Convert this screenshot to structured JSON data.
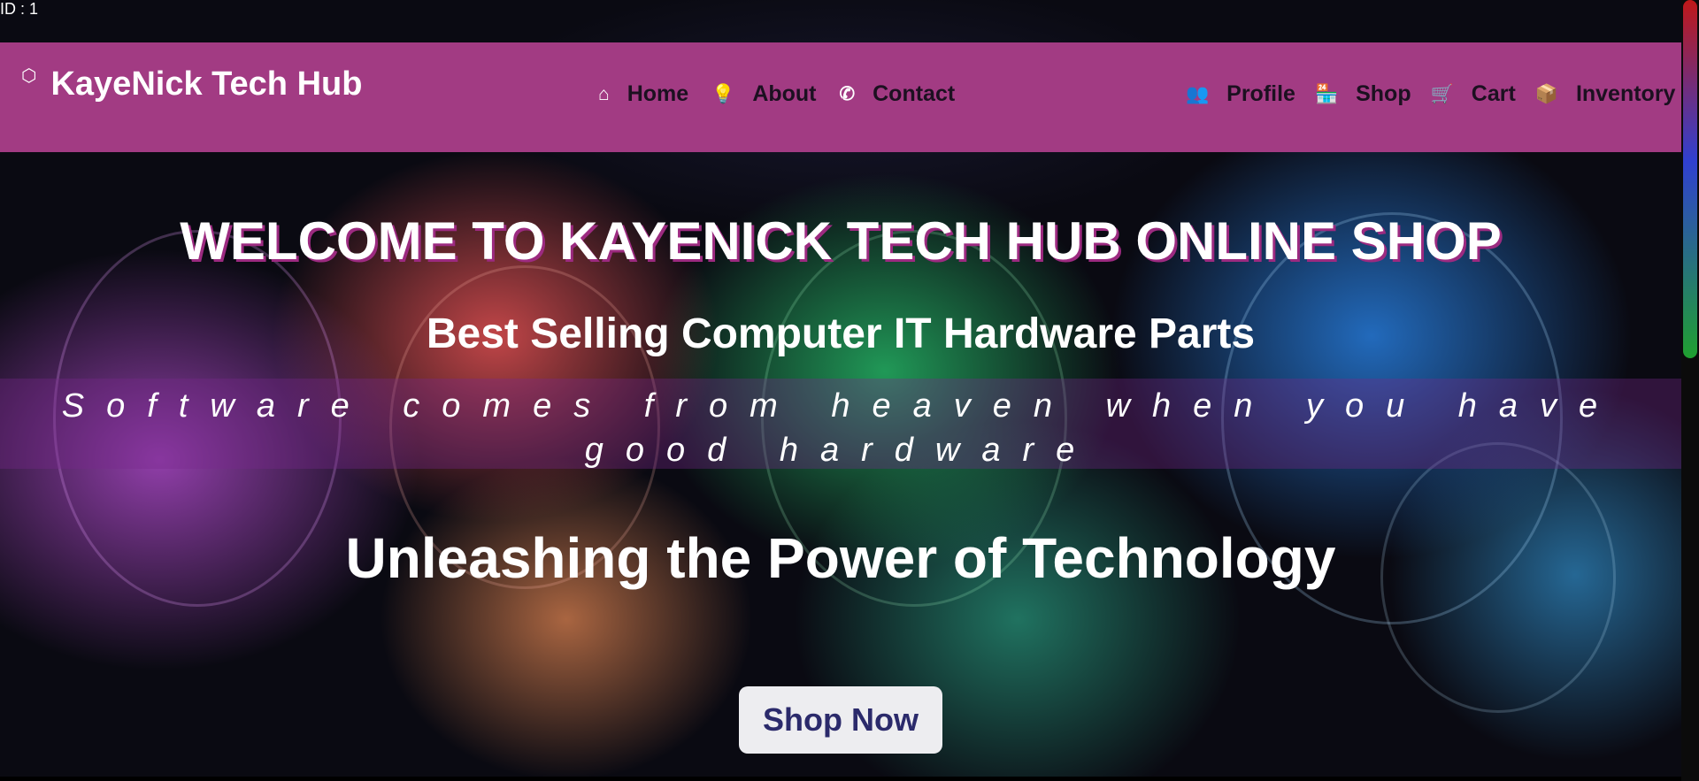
{
  "id_label": "ID : 1",
  "brand": {
    "name": "KayeNick Tech Hub",
    "icon": "hexagon-icon"
  },
  "nav_center": [
    {
      "label": "Home",
      "icon": "home-icon",
      "glyph": "⌂"
    },
    {
      "label": "About",
      "icon": "lightbulb-icon",
      "glyph": "💡"
    },
    {
      "label": "Contact",
      "icon": "phone-icon",
      "glyph": "✆"
    }
  ],
  "nav_right": [
    {
      "label": "Profile",
      "icon": "users-icon",
      "glyph": "👥"
    },
    {
      "label": "Shop",
      "icon": "store-icon",
      "glyph": "🏪"
    },
    {
      "label": "Cart",
      "icon": "cart-icon",
      "glyph": "🛒"
    },
    {
      "label": "Inventory",
      "icon": "box-icon",
      "glyph": "📦"
    }
  ],
  "hero": {
    "welcome": "WELCOME TO KAYENICK TECH HUB ONLINE SHOP",
    "best_selling": "Best Selling Computer IT Hardware Parts",
    "quote": "Software comes from heaven when you have good hardware",
    "tagline": "Unleashing the Power of Technology",
    "cta": "Shop Now"
  },
  "colors": {
    "nav_bg": "#a23b83",
    "cta_text": "#2b2a6b",
    "cta_bg": "#ededf0"
  }
}
